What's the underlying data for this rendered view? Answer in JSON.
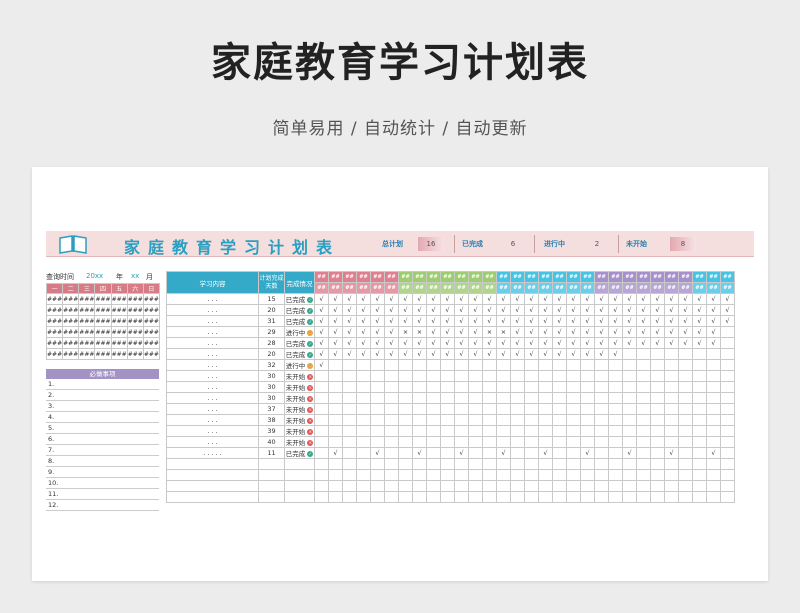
{
  "page": {
    "title": "家庭教育学习计划表",
    "subtitle": "简单易用 / 自动统计 / 自动更新"
  },
  "banner": {
    "title": "家庭教育学习计划表",
    "stats": [
      {
        "label": "总计划",
        "value": "16"
      },
      {
        "label": "已完成",
        "value": "6"
      },
      {
        "label": "进行中",
        "value": "2"
      },
      {
        "label": "未开始",
        "value": "8"
      }
    ]
  },
  "calendar": {
    "query_label": "查询时间",
    "year": "20xx",
    "year_unit": "年",
    "month": "xx",
    "month_unit": "月",
    "weekdays": [
      "一",
      "二",
      "三",
      "四",
      "五",
      "六",
      "日"
    ],
    "cell": "###",
    "rows": 6
  },
  "must_do": {
    "title": "必做事项",
    "items": [
      "1.",
      "2.",
      "3.",
      "4.",
      "5.",
      "6.",
      "7.",
      "8.",
      "9.",
      "10.",
      "11.",
      "12."
    ]
  },
  "grid": {
    "headers": {
      "content": "学习内容",
      "days": "计划完成天数",
      "status": "完成情况"
    },
    "day_label": "##",
    "day_colors": [
      "#e07f8f",
      "#e07f8f",
      "#e07f8f",
      "#e07f8f",
      "#e07f8f",
      "#e07f8f",
      "#9ccd6e",
      "#9ccd6e",
      "#9ccd6e",
      "#9ccd6e",
      "#9ccd6e",
      "#9ccd6e",
      "#9ccd6e",
      "#45c4e5",
      "#45c4e5",
      "#45c4e5",
      "#45c4e5",
      "#45c4e5",
      "#45c4e5",
      "#45c4e5",
      "#a691cc",
      "#a691cc",
      "#a691cc",
      "#a691cc",
      "#a691cc",
      "#a691cc",
      "#a691cc",
      "#45c4e5",
      "#45c4e5",
      "#45c4e5"
    ],
    "rows": [
      {
        "content": ". . .",
        "days": "15",
        "status": "已完成",
        "state": "done",
        "marks": "√√√√√√√√√√√√√√√√√√√√√√√√√√√√√√"
      },
      {
        "content": ". . .",
        "days": "20",
        "status": "已完成",
        "state": "done",
        "marks": "√√√√√√√√√√√√√√√√√√√√√√√√√√√√√√"
      },
      {
        "content": ". . .",
        "days": "31",
        "status": "已完成",
        "state": "done",
        "marks": "√√√√√√√√√√√√√√√√√√√√√√√√√√√√√√"
      },
      {
        "content": ". . .",
        "days": "29",
        "status": "进行中",
        "state": "prog",
        "marks": "√√√√√√××√√√√××√√√√√√√√√√√√√√√ "
      },
      {
        "content": ". . .",
        "days": "28",
        "status": "已完成",
        "state": "done",
        "marks": "√√√√√√√√√√√√√√√√√√√√√√√√√√√√√ "
      },
      {
        "content": ". . .",
        "days": "20",
        "status": "已完成",
        "state": "done",
        "marks": "√√√√√√√√√√√√√√√√√√√√√√         "
      },
      {
        "content": ". . .",
        "days": "32",
        "status": "进行中",
        "state": "prog",
        "marks": "√                             "
      },
      {
        "content": ". . .",
        "days": "30",
        "status": "未开始",
        "state": "todo",
        "marks": "                              "
      },
      {
        "content": ". . .",
        "days": "30",
        "status": "未开始",
        "state": "todo",
        "marks": "                              "
      },
      {
        "content": ". . .",
        "days": "30",
        "status": "未开始",
        "state": "todo",
        "marks": "                              "
      },
      {
        "content": ". . .",
        "days": "37",
        "status": "未开始",
        "state": "todo",
        "marks": "                              "
      },
      {
        "content": ". . .",
        "days": "38",
        "status": "未开始",
        "state": "todo",
        "marks": "                              "
      },
      {
        "content": ". . .",
        "days": "39",
        "status": "未开始",
        "state": "todo",
        "marks": "                              "
      },
      {
        "content": ". . .",
        "days": "40",
        "status": "未开始",
        "state": "todo",
        "marks": "                              "
      },
      {
        "content": ". . . . .",
        "days": "11",
        "status": "已完成",
        "state": "done",
        "marks": " √  √  √  √  √  √  √  √  √  √ "
      },
      {
        "content": "",
        "days": "",
        "status": "",
        "state": "",
        "marks": ""
      },
      {
        "content": "",
        "days": "",
        "status": "",
        "state": "",
        "marks": ""
      },
      {
        "content": "",
        "days": "",
        "status": "",
        "state": "",
        "marks": ""
      },
      {
        "content": "",
        "days": "",
        "status": "",
        "state": "",
        "marks": ""
      }
    ]
  }
}
